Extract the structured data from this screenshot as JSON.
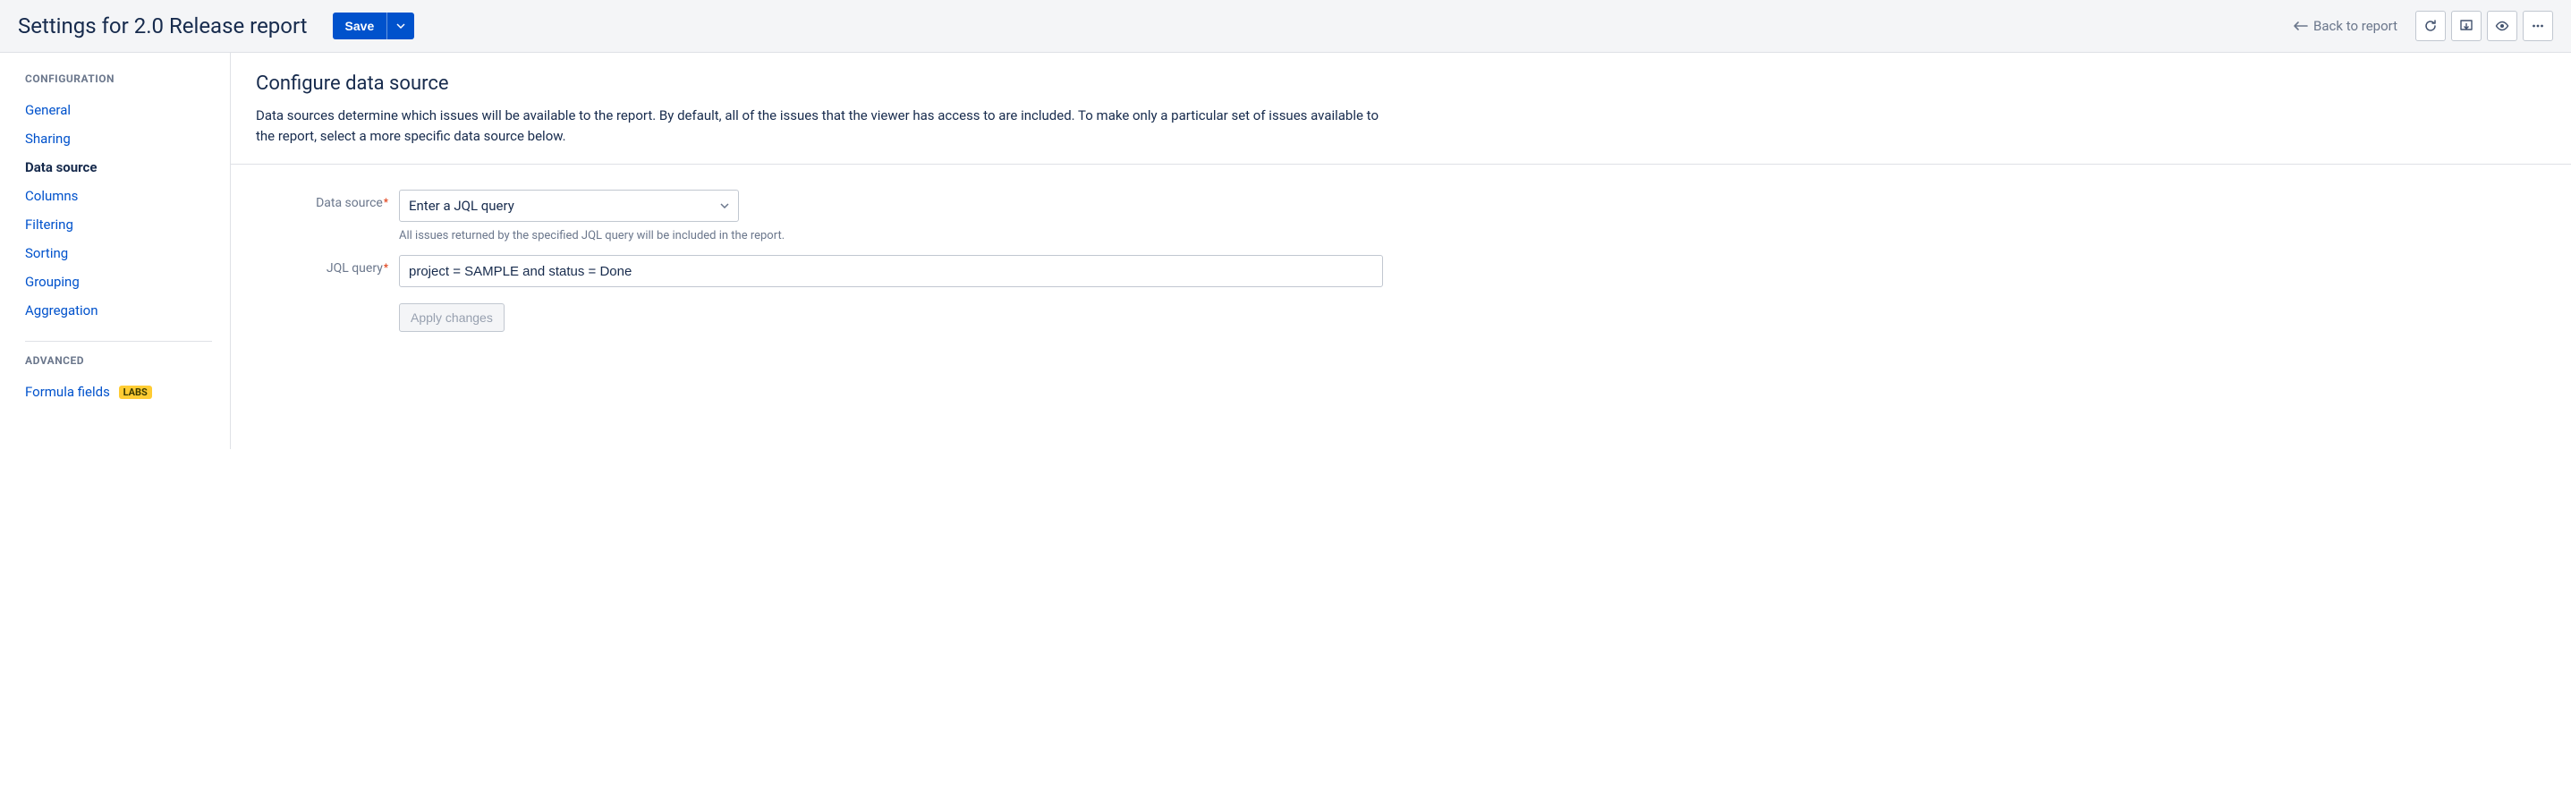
{
  "header": {
    "title": "Settings for 2.0 Release report",
    "save_label": "Save",
    "back_label": "Back to report"
  },
  "sidebar": {
    "group_config": "CONFIGURATION",
    "group_advanced": "ADVANCED",
    "items_config": [
      {
        "label": "General",
        "active": false
      },
      {
        "label": "Sharing",
        "active": false
      },
      {
        "label": "Data source",
        "active": true
      },
      {
        "label": "Columns",
        "active": false
      },
      {
        "label": "Filtering",
        "active": false
      },
      {
        "label": "Sorting",
        "active": false
      },
      {
        "label": "Grouping",
        "active": false
      },
      {
        "label": "Aggregation",
        "active": false
      }
    ],
    "formula_fields_label": "Formula fields",
    "labs_badge": "LABS"
  },
  "main": {
    "title": "Configure data source",
    "description": "Data sources determine which issues will be available to the report. By default, all of the issues that the viewer has access to are included. To make only a particular set of issues available to the report, select a more specific data source below.",
    "data_source_label": "Data source",
    "data_source_value": "Enter a JQL query",
    "data_source_help": "All issues returned by the specified JQL query will be included in the report.",
    "jql_label": "JQL query",
    "jql_value": "project = SAMPLE and status = Done",
    "apply_label": "Apply changes"
  }
}
